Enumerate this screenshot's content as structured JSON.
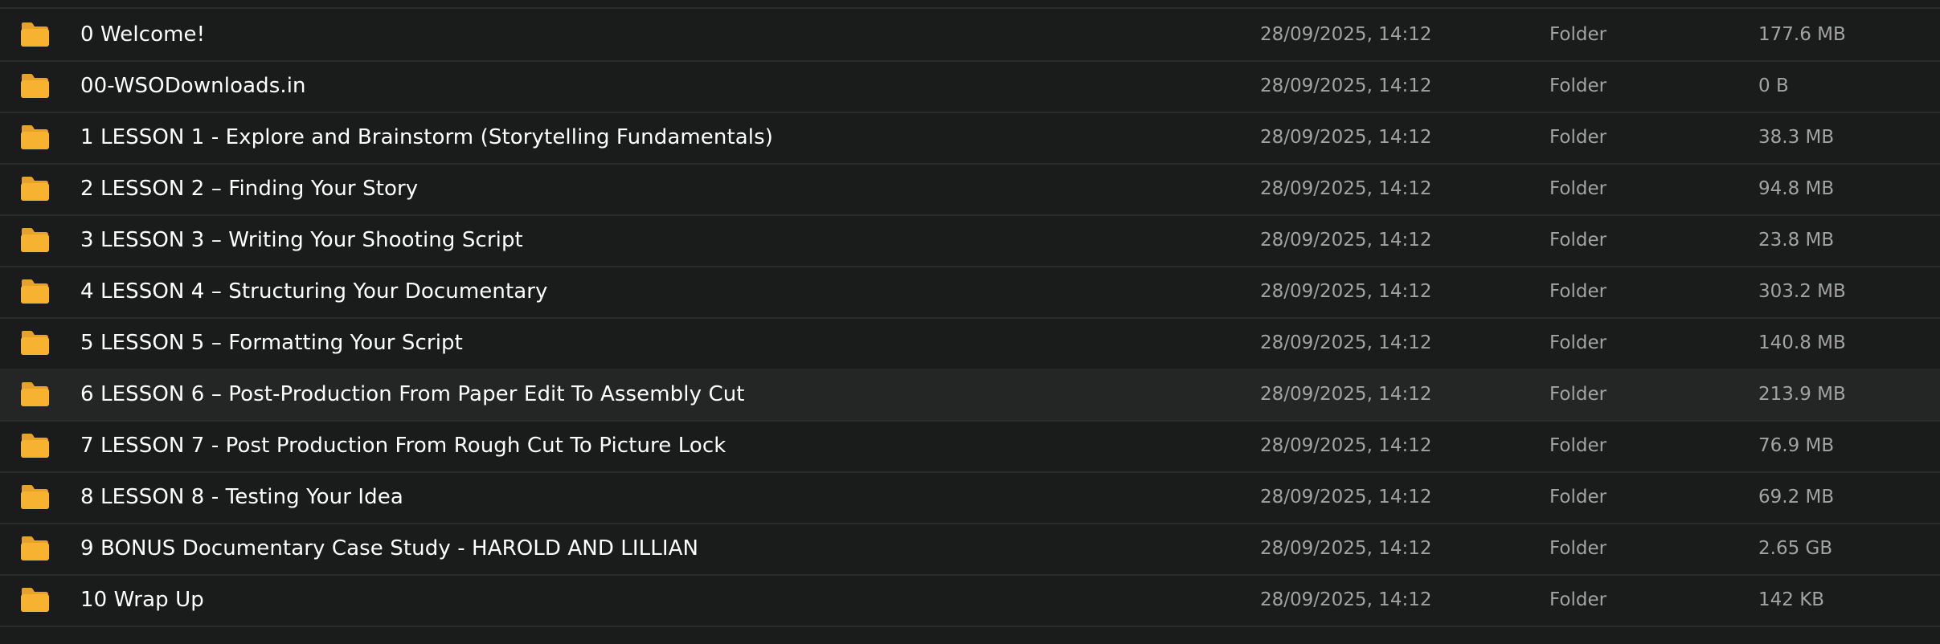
{
  "colors": {
    "background": "#1a1b1b",
    "row_selected": "#242525",
    "divider": "#2b2c2c",
    "folder": "#f7b232",
    "folder_back": "#e8a22a",
    "name_text": "#ffffff",
    "meta_text": "#a3a3a3"
  },
  "row_icon": "folder-icon",
  "selected_row": 7,
  "rows": [
    {
      "name": "0 Welcome!",
      "date": "28/09/2025, 14:12",
      "kind": "Folder",
      "size": "177.6 MB"
    },
    {
      "name": "00-WSODownloads.in",
      "date": "28/09/2025, 14:12",
      "kind": "Folder",
      "size": "0 B"
    },
    {
      "name": "1 LESSON 1 - Explore and Brainstorm (Storytelling Fundamentals)",
      "date": "28/09/2025, 14:12",
      "kind": "Folder",
      "size": "38.3 MB"
    },
    {
      "name": "2 LESSON 2 – Finding Your Story",
      "date": "28/09/2025, 14:12",
      "kind": "Folder",
      "size": "94.8 MB"
    },
    {
      "name": "3 LESSON 3 – Writing Your Shooting Script",
      "date": "28/09/2025, 14:12",
      "kind": "Folder",
      "size": "23.8 MB"
    },
    {
      "name": "4 LESSON 4 – Structuring Your Documentary",
      "date": "28/09/2025, 14:12",
      "kind": "Folder",
      "size": "303.2 MB"
    },
    {
      "name": "5 LESSON 5 – Formatting Your Script",
      "date": "28/09/2025, 14:12",
      "kind": "Folder",
      "size": "140.8 MB"
    },
    {
      "name": "6 LESSON 6 – Post-Production From Paper Edit To Assembly Cut",
      "date": "28/09/2025, 14:12",
      "kind": "Folder",
      "size": "213.9 MB"
    },
    {
      "name": "7 LESSON 7 - Post Production From Rough Cut To Picture Lock",
      "date": "28/09/2025, 14:12",
      "kind": "Folder",
      "size": "76.9 MB"
    },
    {
      "name": "8 LESSON 8 - Testing Your Idea",
      "date": "28/09/2025, 14:12",
      "kind": "Folder",
      "size": "69.2 MB"
    },
    {
      "name": "9 BONUS Documentary Case Study - HAROLD AND LILLIAN",
      "date": "28/09/2025, 14:12",
      "kind": "Folder",
      "size": "2.65 GB"
    },
    {
      "name": "10 Wrap Up",
      "date": "28/09/2025, 14:12",
      "kind": "Folder",
      "size": "142 KB"
    }
  ]
}
